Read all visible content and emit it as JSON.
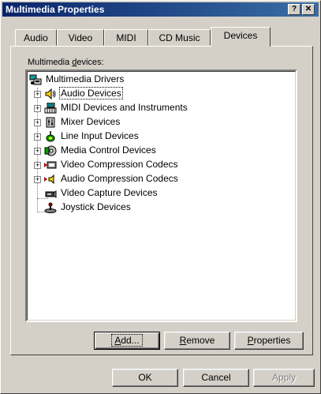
{
  "window": {
    "title": "Multimedia Properties",
    "help_glyph": "?",
    "close_glyph": "✕"
  },
  "tabs": [
    {
      "label": "Audio"
    },
    {
      "label": "Video"
    },
    {
      "label": "MIDI"
    },
    {
      "label": "CD Music"
    },
    {
      "label": "Devices"
    }
  ],
  "active_tab": "Devices",
  "devices": {
    "group_label_prefix": "Multimedia ",
    "group_label_accel": "d",
    "group_label_suffix": "evices:",
    "root": "Multimedia Drivers",
    "items": [
      {
        "label": "Audio Devices",
        "icon": "speaker-icon",
        "expandable": true,
        "selected": true
      },
      {
        "label": "MIDI Devices and Instruments",
        "icon": "midi-keyboard-icon",
        "expandable": true
      },
      {
        "label": "Mixer Devices",
        "icon": "mixer-icon",
        "expandable": true
      },
      {
        "label": "Line Input Devices",
        "icon": "line-input-icon",
        "expandable": true
      },
      {
        "label": "Media Control Devices",
        "icon": "media-control-icon",
        "expandable": true
      },
      {
        "label": "Video Compression Codecs",
        "icon": "video-codec-icon",
        "expandable": true
      },
      {
        "label": "Audio Compression Codecs",
        "icon": "audio-codec-icon",
        "expandable": true
      },
      {
        "label": "Video Capture Devices",
        "icon": "video-capture-icon",
        "expandable": false
      },
      {
        "label": "Joystick Devices",
        "icon": "joystick-icon",
        "expandable": false
      }
    ]
  },
  "panel_buttons": {
    "add": {
      "accel": "A",
      "rest": "dd..."
    },
    "remove": {
      "accel": "R",
      "rest": "emove"
    },
    "properties": {
      "accel": "P",
      "rest": "roperties"
    }
  },
  "dialog_buttons": {
    "ok": "OK",
    "cancel": "Cancel",
    "apply": "Apply"
  },
  "colors": {
    "titlebar": "#0a246a",
    "face": "#d4d0c8",
    "window_bg": "#ffffff"
  }
}
